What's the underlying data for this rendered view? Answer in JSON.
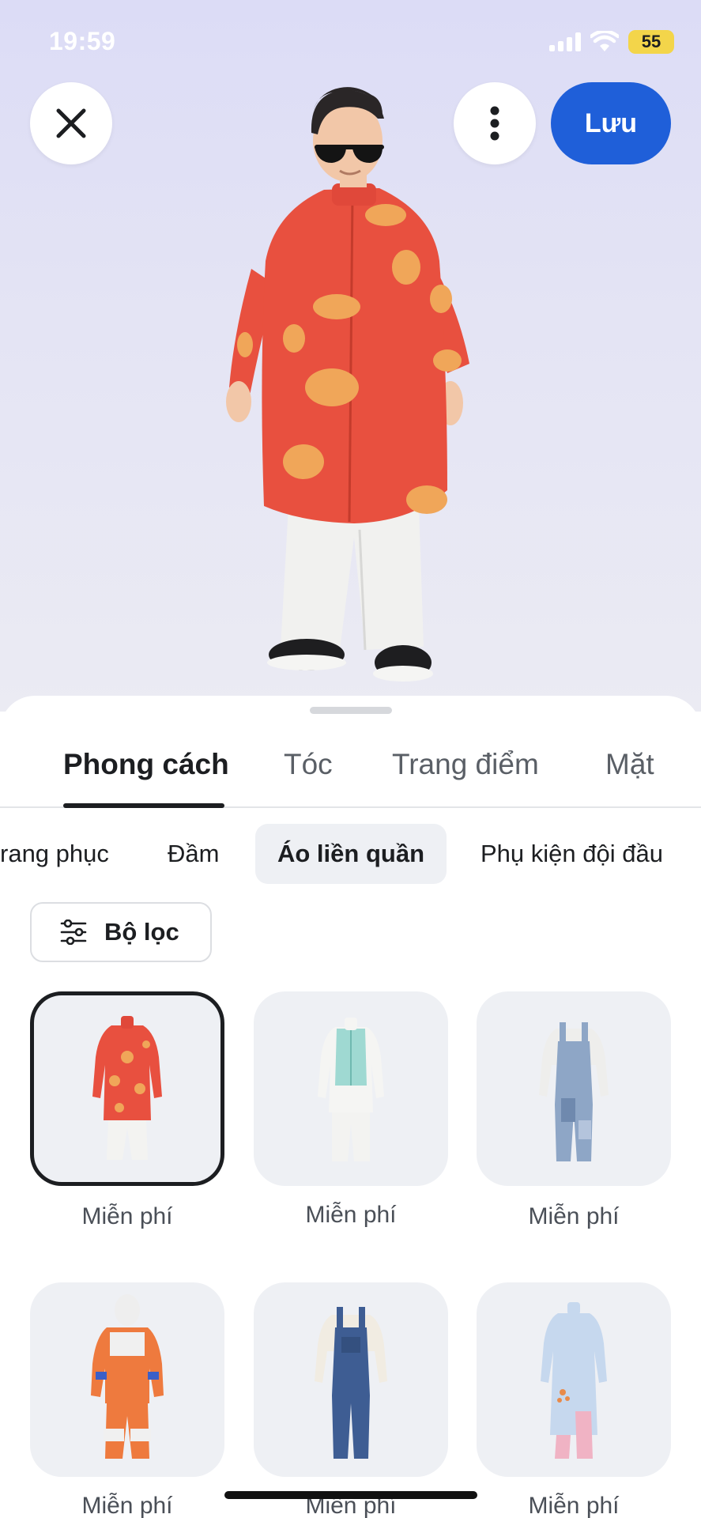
{
  "status_bar": {
    "time": "19:59",
    "battery": "55"
  },
  "header": {
    "close_icon": "close-icon",
    "more_icon": "more-vertical-icon",
    "save_label": "Lưu"
  },
  "tabs": [
    {
      "label": "Phong cách",
      "active": true
    },
    {
      "label": "Tóc",
      "active": false
    },
    {
      "label": "Trang điểm",
      "active": false
    },
    {
      "label": "Mặt",
      "active": false
    }
  ],
  "categories": [
    {
      "label": "rang phục",
      "active": false
    },
    {
      "label": "Đầm",
      "active": false
    },
    {
      "label": "Áo liền quần",
      "active": true
    },
    {
      "label": "Phụ kiện đội đầu",
      "active": false
    }
  ],
  "filter": {
    "label": "Bộ lọc",
    "icon": "sliders-icon"
  },
  "items": [
    {
      "label": "Miễn phí",
      "outfit": "red-ao-dai",
      "selected": true
    },
    {
      "label": "Miễn phí",
      "outfit": "teal-vest-white-suit",
      "selected": false
    },
    {
      "label": "Miễn phí",
      "outfit": "patched-denim-overalls",
      "selected": false
    },
    {
      "label": "Miễn phí",
      "outfit": "orange-astronaut-suit",
      "selected": false
    },
    {
      "label": "Miễn phí",
      "outfit": "denim-overalls",
      "selected": false
    },
    {
      "label": "Miễn phí",
      "outfit": "light-blue-ao-dai",
      "selected": false
    }
  ],
  "colors": {
    "accent": "#1f5fd9",
    "outfit_red": "#e8503f",
    "outfit_gold": "#f0a659"
  }
}
